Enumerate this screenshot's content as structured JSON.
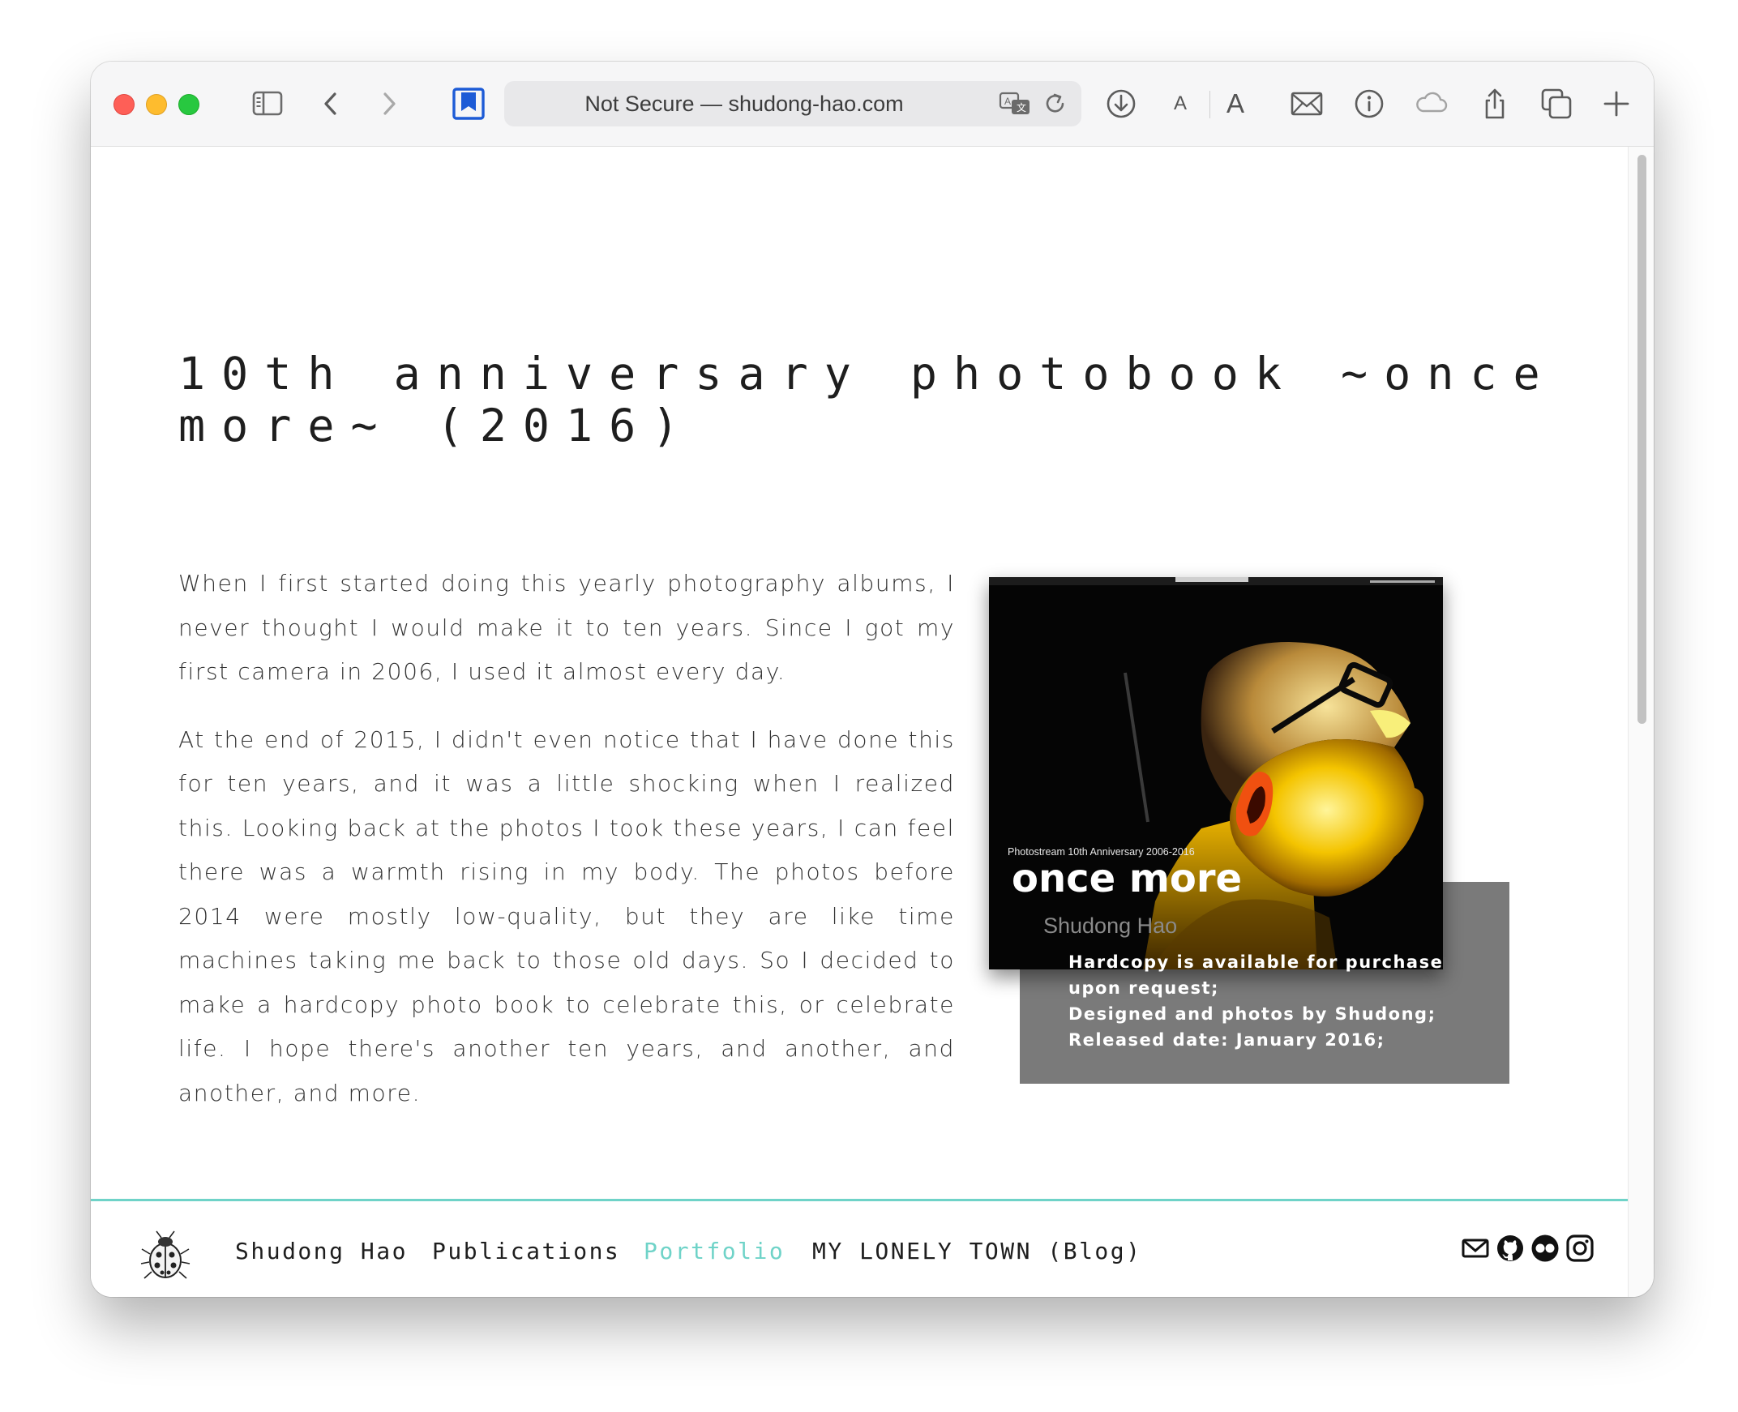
{
  "browser": {
    "address_text": "Not Secure — shudong-hao.com",
    "font_small_label": "A",
    "font_large_label": "A",
    "traffic_colors": {
      "close": "#fe5f57",
      "minimize": "#febc2e",
      "maximize": "#28c840"
    },
    "bookmark_color": "#1d5bd6",
    "icons": [
      "sidebar-icon",
      "back-icon",
      "forward-icon",
      "bookmark-icon",
      "translate-icon",
      "reload-icon",
      "download-icon",
      "mail-icon",
      "info-icon",
      "cloud-icon",
      "share-icon",
      "tabs-icon",
      "new-tab-icon"
    ]
  },
  "article": {
    "title": "10th anniversary photobook ~once more~ (2016)",
    "paragraphs": [
      "When I first started doing this yearly photography albums, I never thought I would make it to ten years. Since I got my first camera in 2006, I used it almost every day.",
      "At the end of 2015, I didn't even notice that I have done this for ten years, and it was a little shocking when I realized this. Looking back at the photos I took these years, I can feel there was a warmth rising in my body. The photos before 2014 were mostly low-quality, but they are like time machines taking me back to those old days. So I decided to make a hardcopy photo book to celebrate this, or celebrate life. I hope there's another ten years, and another, and another, and more."
    ],
    "cover": {
      "subtitle": "Photostream 10th Anniversary 2006-2016",
      "title": "once more",
      "author": "Shudong Hao"
    },
    "caption": [
      "Hardcopy is available for purchase upon request;",
      "Designed and photos by Shudong;",
      "Released date: January 2016;"
    ]
  },
  "footer": {
    "accent_color": "#6fd3c8",
    "nav": [
      {
        "label": "Shudong Hao",
        "active": false
      },
      {
        "label": "Publications",
        "active": false
      },
      {
        "label": "Portfolio",
        "active": true
      },
      {
        "label": "MY LONELY TOWN (Blog)",
        "active": false
      }
    ],
    "social_icons": [
      "email-icon",
      "github-icon",
      "flickr-icon",
      "instagram-icon"
    ]
  }
}
